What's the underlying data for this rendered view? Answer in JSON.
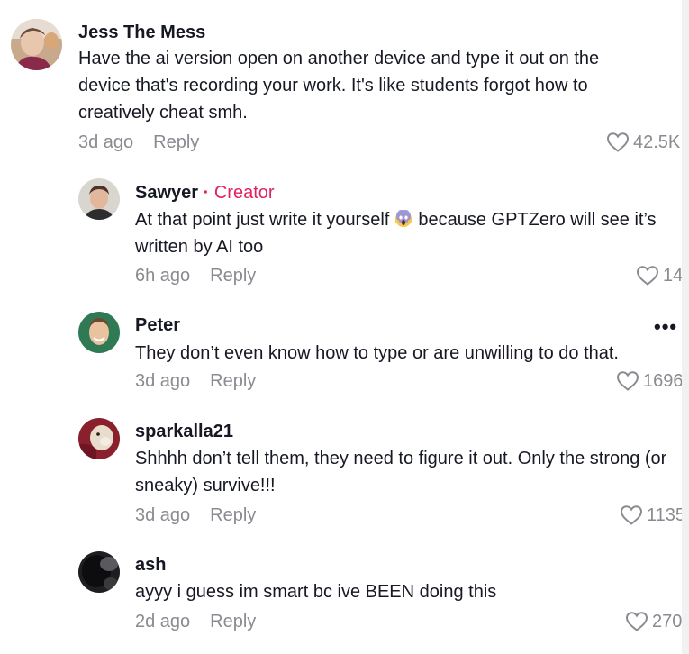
{
  "comments": [
    {
      "author": "Jess The Mess",
      "text": "Have the ai version open on another device and type it out on the device that's recording your work. It's like students forgot how to creatively cheat smh.",
      "time": "3d ago",
      "reply_label": "Reply",
      "likes": "42.5K"
    },
    {
      "author": "Sawyer",
      "separator": "·",
      "badge": "Creator",
      "text_before_emoji": "At that point just write it yourself",
      "emoji": "screaming-face-emoji",
      "text_after_emoji": "because GPTZero will see it’s written by AI too",
      "time": "6h ago",
      "reply_label": "Reply",
      "likes": "14"
    },
    {
      "author": "Peter",
      "more_label": "•••",
      "text": "They don’t even know how to type or are unwilling to do that.",
      "time": "3d ago",
      "reply_label": "Reply",
      "likes": "1696"
    },
    {
      "author": "sparkalla21",
      "text": "Shhhh don’t tell them, they need to figure it out. Only the strong (or sneaky) survive!!!",
      "time": "3d ago",
      "reply_label": "Reply",
      "likes": "1135"
    },
    {
      "author": "ash",
      "text": "ayyy i guess im smart bc ive BEEN doing this",
      "time": "2d ago",
      "reply_label": "Reply",
      "likes": "270"
    }
  ],
  "icons": {
    "like": "heart-outline-icon",
    "more": "more-options-icon"
  },
  "colors": {
    "text": "#161823",
    "secondary": "#8a8b91",
    "creator": "#e0245e"
  }
}
